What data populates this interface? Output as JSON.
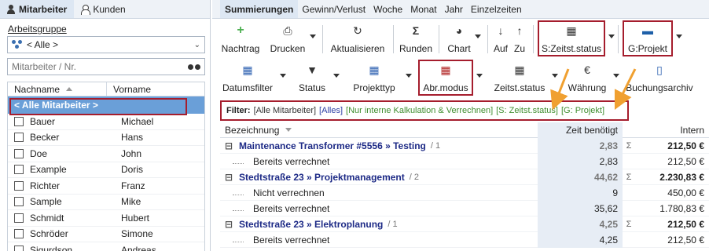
{
  "left_tabs": [
    {
      "label": "Mitarbeiter",
      "active": true
    },
    {
      "label": "Kunden",
      "active": false
    }
  ],
  "workgroup": {
    "label": "Arbeitsgruppe",
    "selected": "< Alle >"
  },
  "search": {
    "placeholder": "Mitarbeiter / Nr."
  },
  "employee_grid": {
    "columns": [
      "Nachname",
      "Vorname"
    ],
    "all_row": "< Alle Mitarbeiter >",
    "rows": [
      {
        "last": "Bauer",
        "first": "Michael"
      },
      {
        "last": "Becker",
        "first": "Hans"
      },
      {
        "last": "Doe",
        "first": "John"
      },
      {
        "last": "Example",
        "first": "Doris"
      },
      {
        "last": "Richter",
        "first": "Franz"
      },
      {
        "last": "Sample",
        "first": "Mike"
      },
      {
        "last": "Schmidt",
        "first": "Hubert"
      },
      {
        "last": "Schröder",
        "first": "Simone"
      },
      {
        "last": "Sigurdson",
        "first": "Andreas"
      }
    ]
  },
  "right_tabs": [
    "Summierungen",
    "Gewinn/Verlust",
    "Woche",
    "Monat",
    "Jahr",
    "Einzelzeiten"
  ],
  "toolbar1": {
    "nachtrag": "Nachtrag",
    "drucken": "Drucken",
    "aktualisieren": "Aktualisieren",
    "runden": "Runden",
    "chart": "Chart",
    "auf": "Auf",
    "zu": "Zu",
    "zeitst_status": "S:Zeitst.status",
    "projekt": "G:Projekt"
  },
  "toolbar2": {
    "datumsfilter": "Datumsfilter",
    "status": "Status",
    "projekttyp": "Projekttyp",
    "abr_modus": "Abr.modus",
    "zeitst_status": "Zeitst.status",
    "waehrung": "Währung",
    "buchungsarchiv": "Buchungsarchiv"
  },
  "filter": {
    "label": "Filter:",
    "all_employees": "[Alle Mitarbeiter]",
    "all": "[Alles]",
    "billing": "[Nur interne Kalkulation & Verrechnen]",
    "s_status": "[S: Zeitst.status]",
    "g_project": "[G: Projekt]"
  },
  "result_table": {
    "columns": {
      "name": "Bezeichnung",
      "time": "Zeit benötigt",
      "intern": "Intern"
    },
    "rows": [
      {
        "type": "group",
        "name": "Maintenance Transformer #5556 » Testing",
        "count": "/ 1",
        "time": "2,83",
        "sigma": "Σ",
        "intern": "212,50 €"
      },
      {
        "type": "sub",
        "name": "Bereits verrechnet",
        "time": "2,83",
        "sigma": "",
        "intern": "212,50 €"
      },
      {
        "type": "group",
        "name": "Stedtstraße 23 » Projektmanagement",
        "count": "/ 2",
        "time": "44,62",
        "sigma": "Σ",
        "intern": "2.230,83 €"
      },
      {
        "type": "sub",
        "name": "Nicht verrechnen",
        "time": "9",
        "sigma": "",
        "intern": "450,00 €"
      },
      {
        "type": "sub",
        "name": "Bereits verrechnet",
        "time": "35,62",
        "sigma": "",
        "intern": "1.780,83 €"
      },
      {
        "type": "group",
        "name": "Stedtstraße 23 » Elektroplanung",
        "count": "/ 1",
        "time": "4,25",
        "sigma": "Σ",
        "intern": "212,50 €"
      },
      {
        "type": "sub",
        "name": "Bereits verrechnet",
        "time": "4,25",
        "sigma": "",
        "intern": "212,50 €"
      }
    ]
  },
  "colors": {
    "highlight_border": "#a51d2d",
    "selection_blue": "#6a9fd8",
    "annotation_arrow": "#f0a030",
    "group_text": "#1d2a86"
  }
}
